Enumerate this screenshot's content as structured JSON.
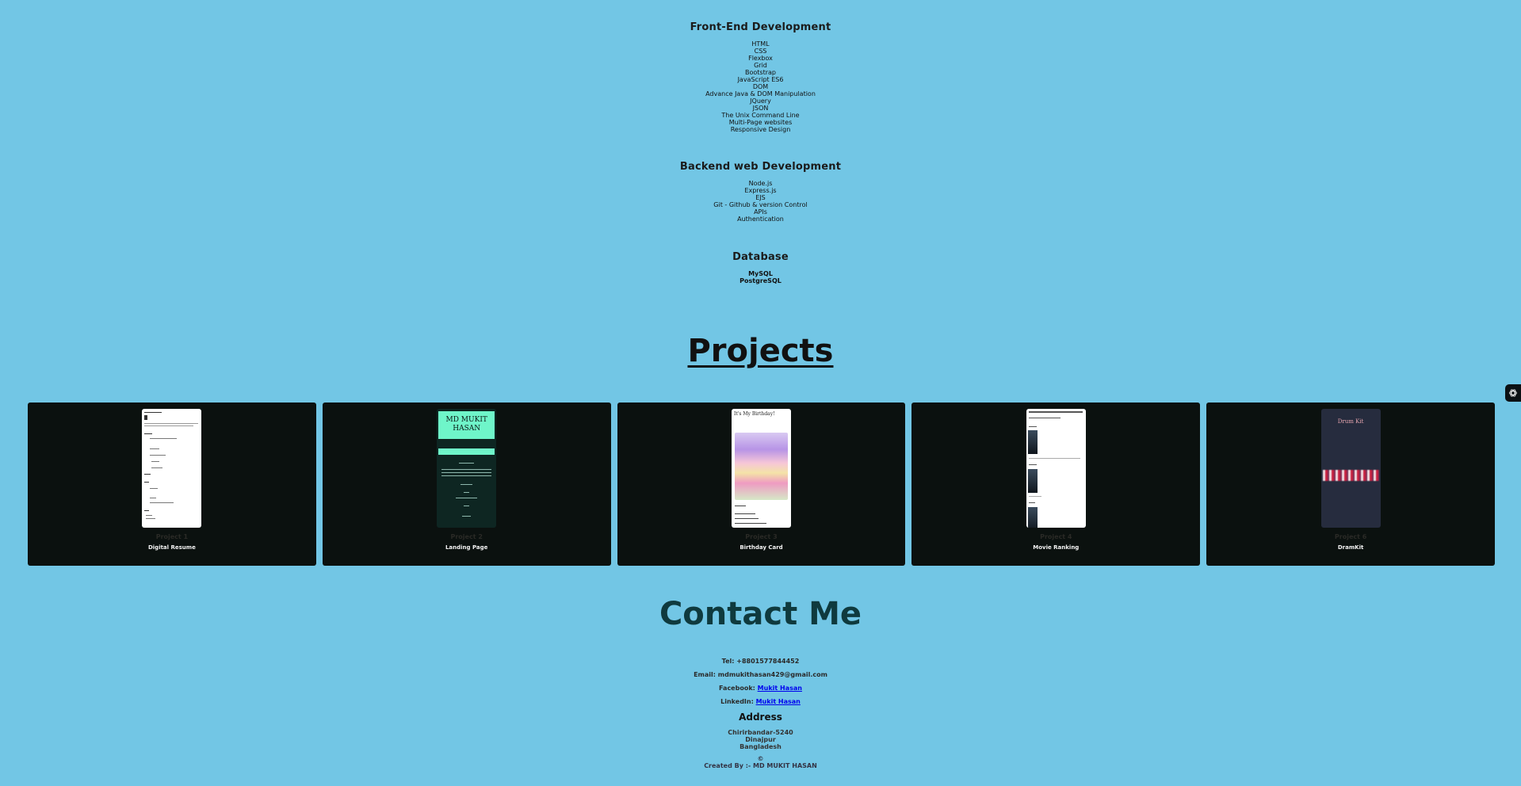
{
  "skills": {
    "frontend": {
      "title": "Front-End Development",
      "items": [
        "HTML",
        "CSS",
        "Flexbox",
        "Grid",
        "Bootstrap",
        "JavaScript ES6",
        "DOM",
        "Advance Java & DOM Manipulation",
        "JQuery",
        "JSON",
        "The Unix Command Line",
        "Multi-Page websites",
        "Responsive Design"
      ]
    },
    "backend": {
      "title": "Backend web Development",
      "items": [
        "Node.js",
        "Express.js",
        "EJS",
        "Git - Github & version Control",
        "APIs",
        "Authentication"
      ]
    },
    "database": {
      "title": "Database",
      "items": [
        "MySQL",
        "PostgreSQL"
      ]
    }
  },
  "projects": {
    "heading": "Projects",
    "cards": [
      {
        "number": "Project 1",
        "name": "Digital Resume"
      },
      {
        "number": "Project 2",
        "name": "Landing Page",
        "thumb_text": "MD MUKIT HASAN"
      },
      {
        "number": "Project 3",
        "name": "Birthday Card",
        "thumb_text": "It's My Birthday!"
      },
      {
        "number": "Project 4",
        "name": "Movie Ranking"
      },
      {
        "number": "Project 6",
        "name": "DramKit",
        "thumb_text": "Drum Kit"
      }
    ]
  },
  "contact": {
    "heading": "Contact Me",
    "tel_label": "Tel:",
    "tel": "+8801577844452",
    "email_label": "Email:",
    "email": "mdmukithasan429@gmail.com",
    "facebook_label": "Facebook:",
    "facebook_link": "Mukit Hasan",
    "linkedin_label": "LinkedIn:",
    "linkedin_link": "Mukit Hasan",
    "address_heading": "Address",
    "address": [
      "Chirirbandar-5240",
      "Dinajpur",
      "Bangladesh"
    ]
  },
  "footer": {
    "copyright": "©",
    "created_by": "Created By :- MD MUKIT HASAN"
  },
  "colors": {
    "background": "#72c6e5",
    "card_background": "#0b110f",
    "contact_heading": "#0f3a3e"
  },
  "icons": {
    "side_widget": "chatgpt-like-icon"
  }
}
